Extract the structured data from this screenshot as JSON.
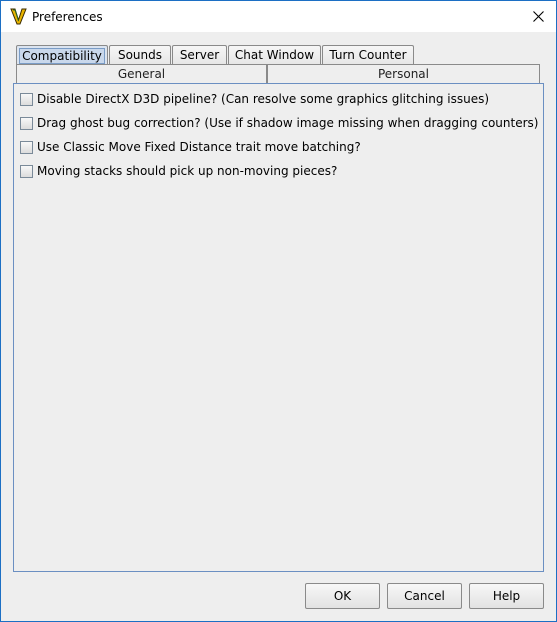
{
  "window": {
    "title": "Preferences",
    "app_icon": "vassal-v-icon",
    "close_icon": "close-icon",
    "accent_color": "#1c6fc4"
  },
  "tabs_top": [
    {
      "label": "Compatibility",
      "selected": true
    },
    {
      "label": "Sounds",
      "selected": false
    },
    {
      "label": "Server",
      "selected": false
    },
    {
      "label": "Chat Window",
      "selected": false
    },
    {
      "label": "Turn Counter",
      "selected": false
    }
  ],
  "tabs_bottom": [
    {
      "label": "General"
    },
    {
      "label": "Personal"
    }
  ],
  "options": [
    {
      "label": "Disable DirectX D3D pipeline? (Can resolve some graphics glitching issues)",
      "checked": false
    },
    {
      "label": "Drag ghost bug correction? (Use if shadow image missing when dragging counters)",
      "checked": false
    },
    {
      "label": "Use Classic Move Fixed Distance trait move batching?",
      "checked": false
    },
    {
      "label": "Moving stacks should pick up non-moving pieces?",
      "checked": false
    }
  ],
  "buttons": {
    "ok": "OK",
    "cancel": "Cancel",
    "help": "Help"
  }
}
